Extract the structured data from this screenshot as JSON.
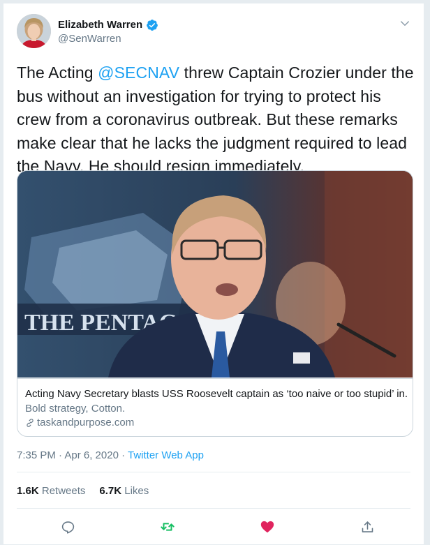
{
  "author": {
    "name": "Elizabeth Warren",
    "handle": "@SenWarren",
    "verified": true,
    "avatar_icon": "profile-photo"
  },
  "tweet": {
    "text_before_mention": "The Acting ",
    "mention": "@SECNAV",
    "text_after_mention": " threw Captain Crozier under the bus without an investigation for trying to protect his crew from a coronavirus outbreak. But these remarks make clear that he lacks the judgment required to lead the Navy. He should resign immediately."
  },
  "card": {
    "image_sign_text": "THE PENTAG",
    "title": "Acting Navy Secretary blasts USS Roosevelt captain as ‘too naive or too stupid’ in...",
    "description": "Bold strategy, Cotton.",
    "domain": "taskandpurpose.com",
    "domain_icon": "link-icon"
  },
  "meta": {
    "timestamp": "7:35 PM · Apr 6, 2020 · ",
    "source": "Twitter Web App"
  },
  "stats": {
    "retweets_count": "1.6K",
    "retweets_label": " Retweets",
    "likes_count": "6.7K",
    "likes_label": " Likes"
  },
  "actions": [
    {
      "name": "reply",
      "icon": "comment-icon"
    },
    {
      "name": "retweet",
      "icon": "retweet-icon"
    },
    {
      "name": "like",
      "icon": "heart-icon"
    },
    {
      "name": "share",
      "icon": "share-icon"
    }
  ],
  "colors": {
    "accent": "#1da1f2",
    "retweet": "#17bf63",
    "like": "#e0245e",
    "secondary_text": "#657786",
    "border": "#ccd6dd"
  }
}
